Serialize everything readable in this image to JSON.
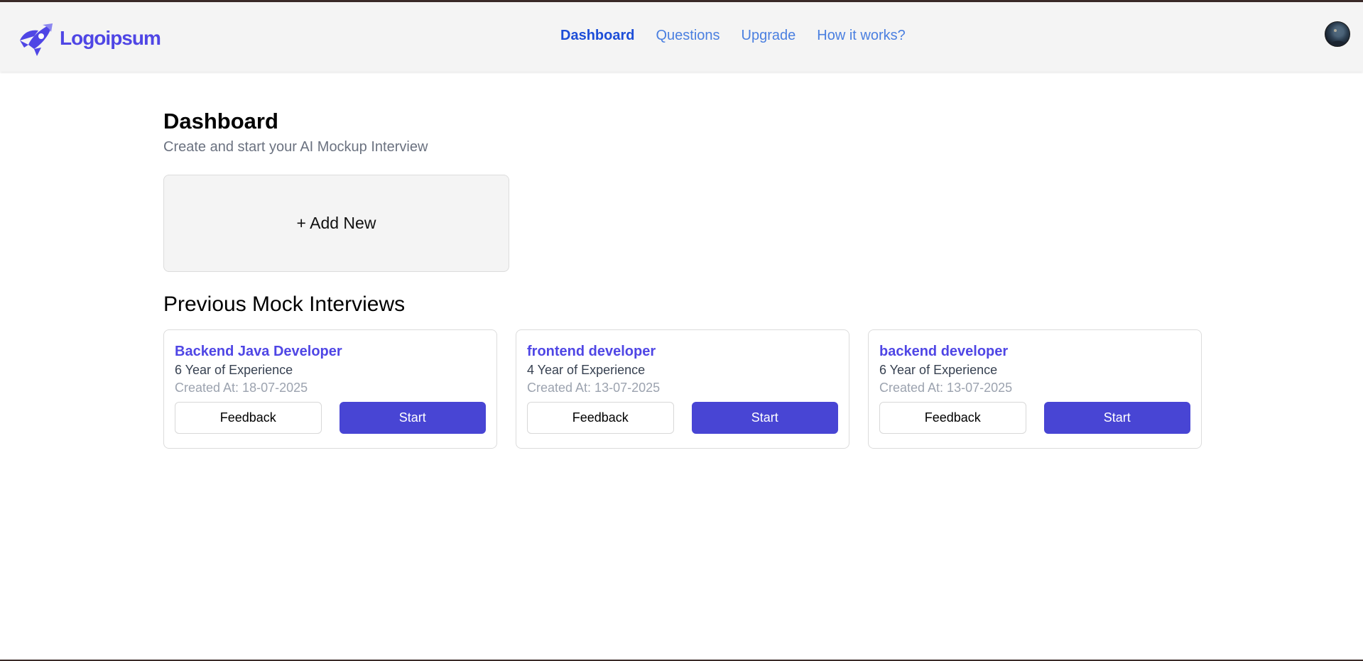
{
  "brand": {
    "name": "Logoipsum",
    "accent": "#4f46e5"
  },
  "nav": {
    "items": [
      {
        "label": "Dashboard",
        "active": true
      },
      {
        "label": "Questions",
        "active": false
      },
      {
        "label": "Upgrade",
        "active": false
      },
      {
        "label": "How it works?",
        "active": false
      }
    ]
  },
  "user": {
    "avatar_icon": "user-avatar"
  },
  "page": {
    "title": "Dashboard",
    "subtitle": "Create and start your AI Mockup Interview",
    "add_new_label": "+ Add New",
    "section_title": "Previous Mock Interviews"
  },
  "interviews": [
    {
      "role": "Backend Java Developer",
      "experience": "6 Year of Experience",
      "created": "Created At: 18-07-2025",
      "feedback_label": "Feedback",
      "start_label": "Start"
    },
    {
      "role": "frontend developer",
      "experience": "4 Year of Experience",
      "created": "Created At: 13-07-2025",
      "feedback_label": "Feedback",
      "start_label": "Start"
    },
    {
      "role": "backend developer",
      "experience": "6 Year of Experience",
      "created": "Created At: 13-07-2025",
      "feedback_label": "Feedback",
      "start_label": "Start"
    }
  ],
  "colors": {
    "primary_button": "#4845d4",
    "nav_link": "#4a7fe0",
    "nav_active": "#1d4ed8"
  }
}
